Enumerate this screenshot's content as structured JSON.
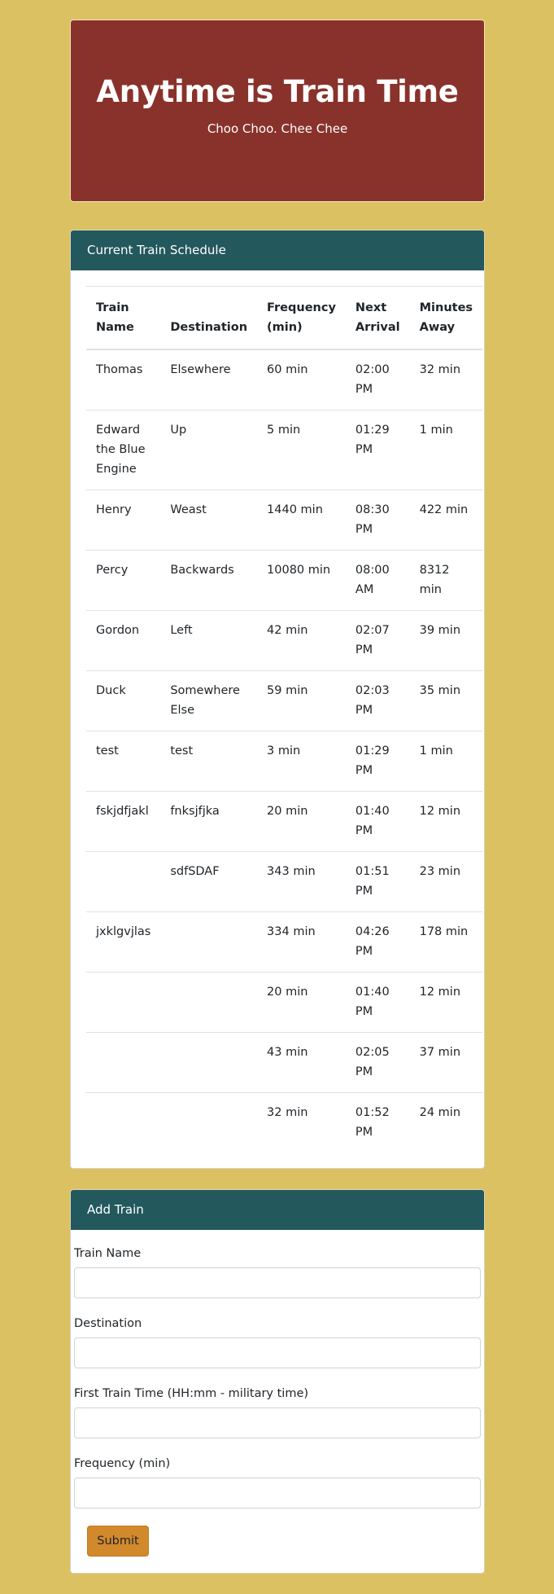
{
  "header": {
    "title": "Anytime is Train Time",
    "subtitle": "Choo Choo. Chee Chee"
  },
  "schedule": {
    "title": "Current Train Schedule",
    "columns": [
      "Train Name",
      "Destination",
      "Frequency (min)",
      "Next Arrival",
      "Minutes Away"
    ],
    "rows": [
      [
        "Thomas",
        "Elsewhere",
        "60 min",
        "02:00 PM",
        "32 min"
      ],
      [
        "Edward the Blue Engine",
        "Up",
        "5 min",
        "01:29 PM",
        "1 min"
      ],
      [
        "Henry",
        "Weast",
        "1440 min",
        "08:30 PM",
        "422 min"
      ],
      [
        "Percy",
        "Backwards",
        "10080 min",
        "08:00 AM",
        "8312 min"
      ],
      [
        "Gordon",
        "Left",
        "42 min",
        "02:07 PM",
        "39 min"
      ],
      [
        "Duck",
        "Somewhere Else",
        "59 min",
        "02:03 PM",
        "35 min"
      ],
      [
        "test",
        "test",
        "3 min",
        "01:29 PM",
        "1 min"
      ],
      [
        "fskjdfjakl",
        "fnksjfjka",
        "20 min",
        "01:40 PM",
        "12 min"
      ],
      [
        "",
        "sdfSDAF",
        "343 min",
        "01:51 PM",
        "23 min"
      ],
      [
        "jxklgvjlas",
        "",
        "334 min",
        "04:26 PM",
        "178 min"
      ],
      [
        "",
        "",
        "20 min",
        "01:40 PM",
        "12 min"
      ],
      [
        "",
        "",
        "43 min",
        "02:05 PM",
        "37 min"
      ],
      [
        "",
        "",
        "32 min",
        "01:52 PM",
        "24 min"
      ]
    ]
  },
  "add_train": {
    "title": "Add Train",
    "name_label": "Train Name",
    "name_value": "",
    "destination_label": "Destination",
    "destination_value": "",
    "time_label": "First Train Time (HH:mm - military time)",
    "time_value": "",
    "frequency_label": "Frequency (min)",
    "frequency_value": "",
    "submit_label": "Submit"
  },
  "colors": {
    "page_background": "#dcc163",
    "jumbotron": "#89322b",
    "card_header": "#23585d",
    "submit_button": "#d1892c"
  }
}
